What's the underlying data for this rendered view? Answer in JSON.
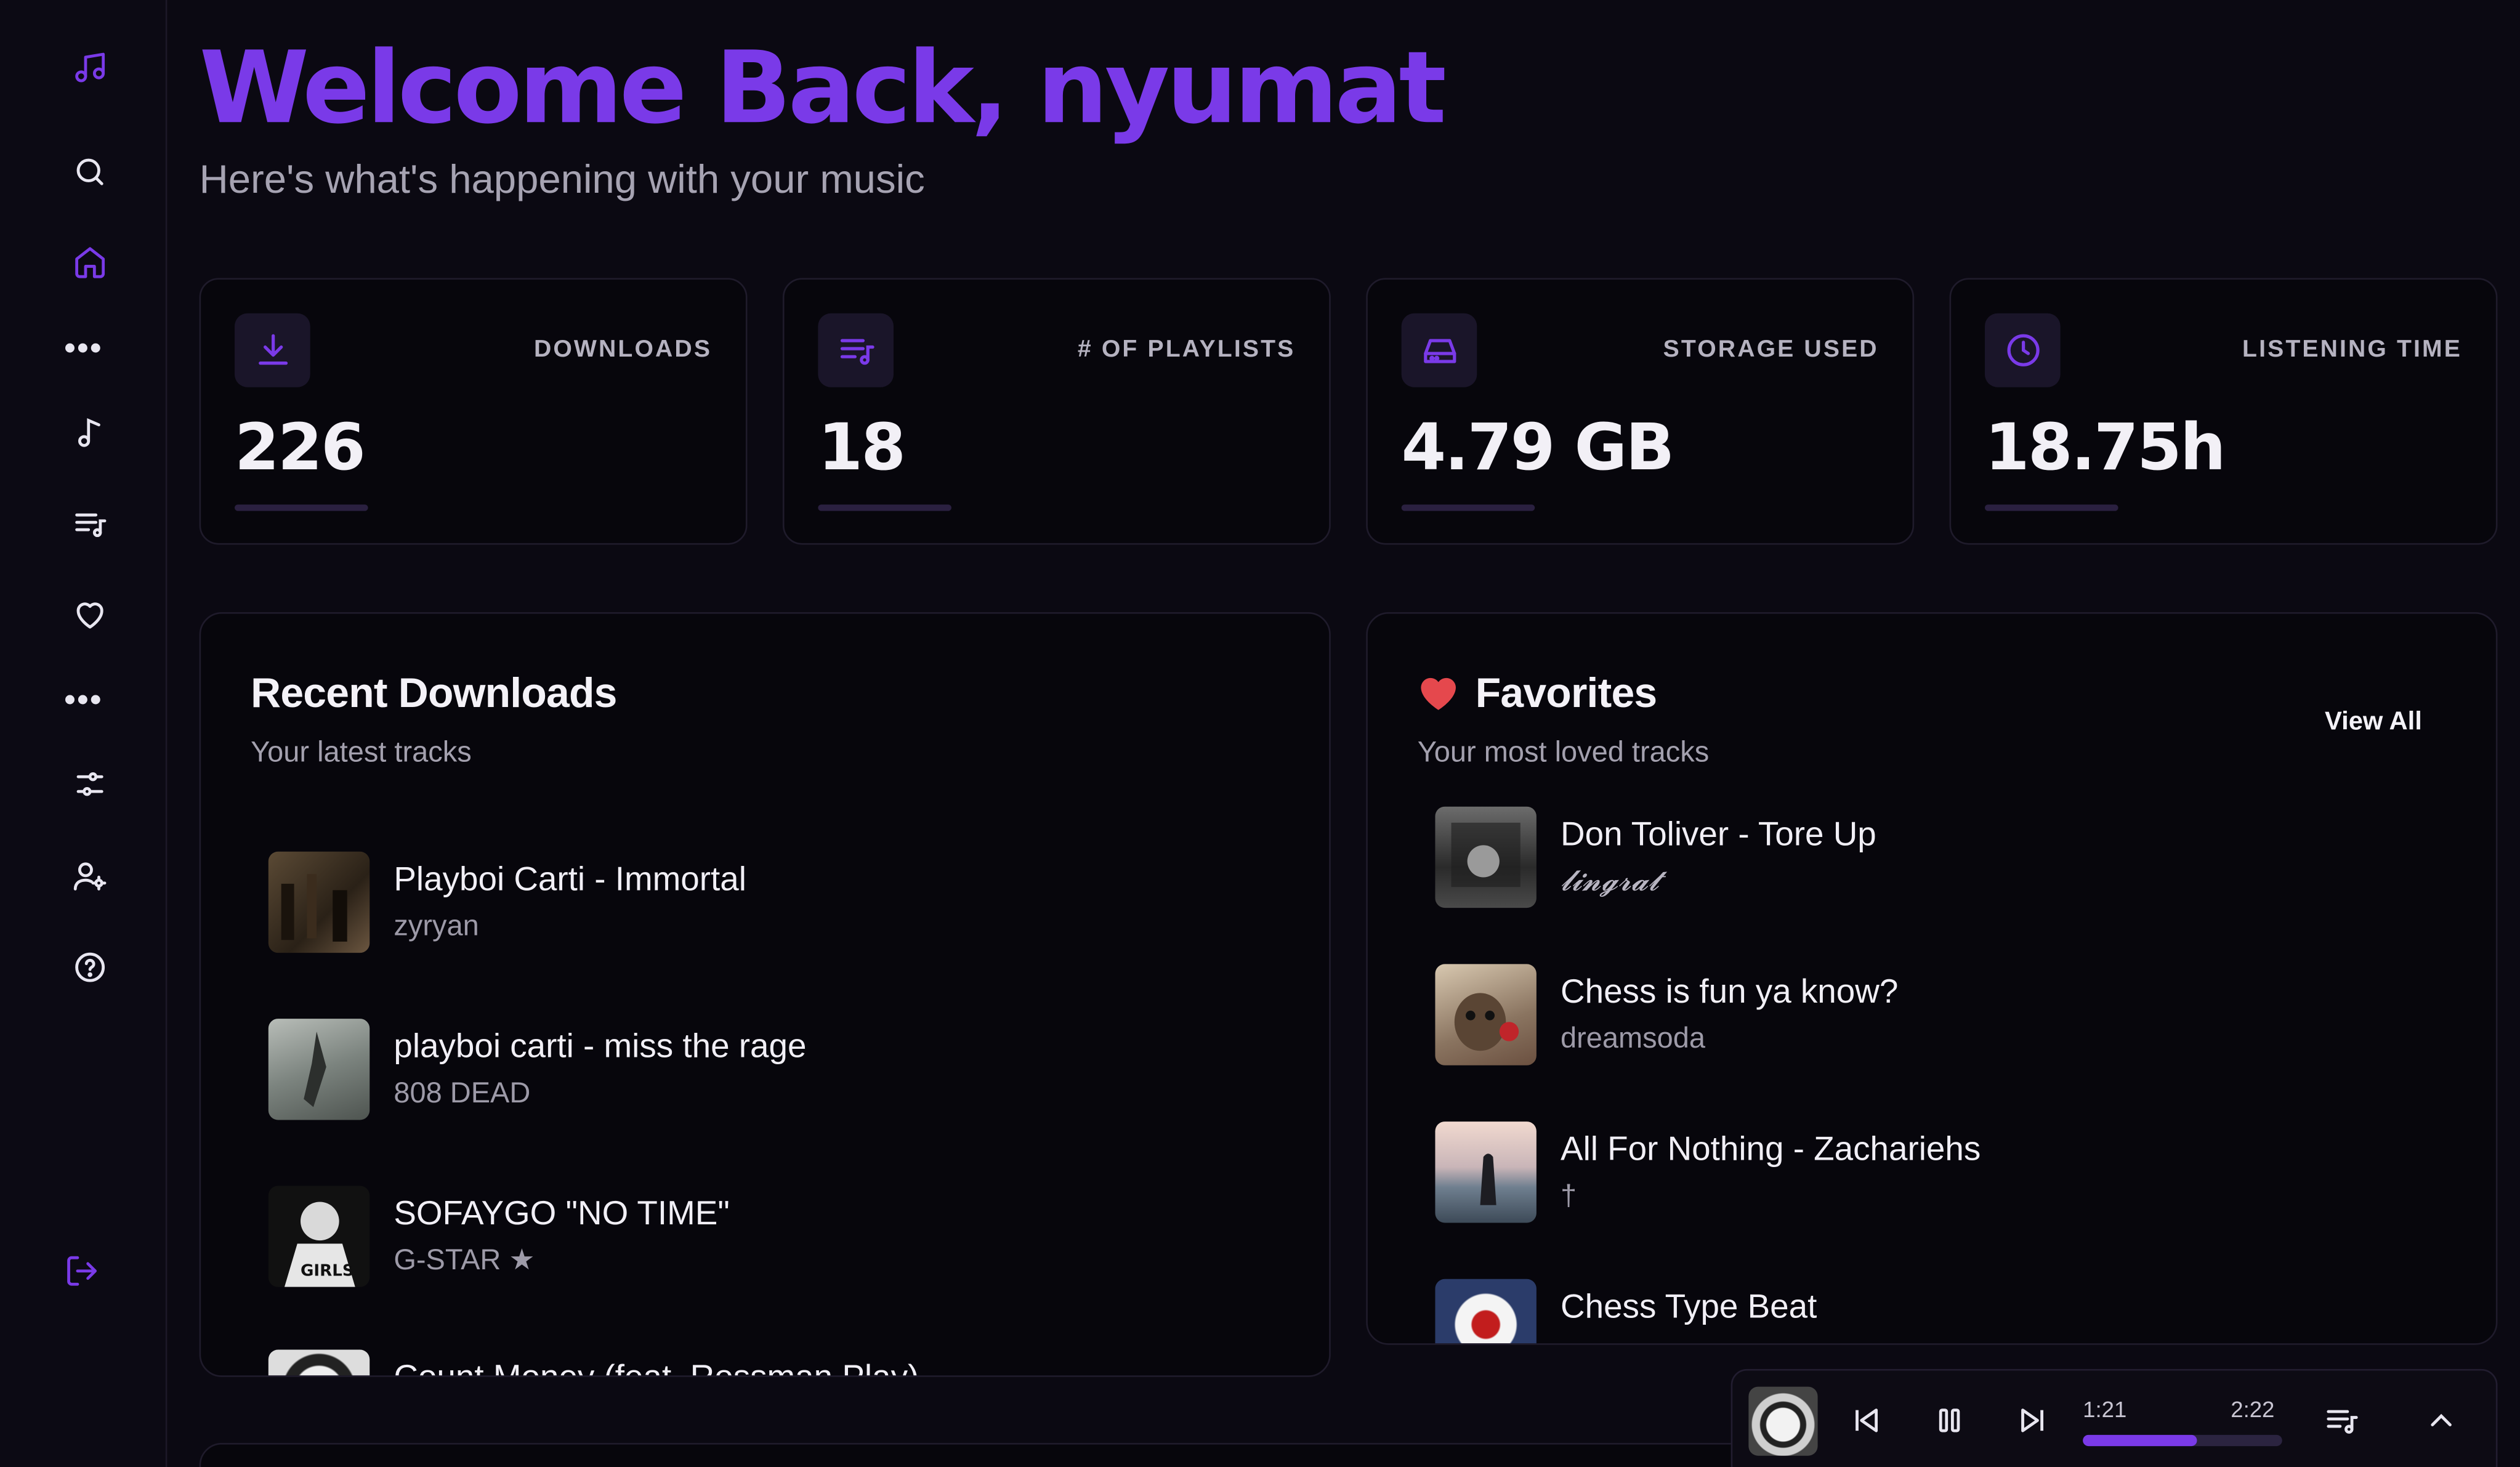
{
  "header": {
    "title": "Welcome Back, nyumat",
    "subtitle": "Here's what's happening with your music"
  },
  "colors": {
    "accent": "#7a3ae8",
    "background": "#0b0912",
    "card": "#07060c",
    "heart": "#e5484d"
  },
  "sidebar": {
    "items": [
      {
        "icon": "music-note-icon"
      },
      {
        "icon": "search-icon"
      },
      {
        "icon": "home-icon",
        "active": true
      },
      {
        "icon": "more-dots-icon"
      },
      {
        "icon": "single-note-icon"
      },
      {
        "icon": "playlist-icon"
      },
      {
        "icon": "heart-icon"
      },
      {
        "icon": "more-dots-icon"
      },
      {
        "icon": "sliders-icon"
      },
      {
        "icon": "user-settings-icon"
      },
      {
        "icon": "help-icon"
      },
      {
        "icon": "logout-icon"
      }
    ]
  },
  "stats": [
    {
      "label": "DOWNLOADS",
      "value": "226",
      "icon": "download-icon"
    },
    {
      "label": "# OF PLAYLISTS",
      "value": "18",
      "icon": "playlist-icon"
    },
    {
      "label": "STORAGE USED",
      "value": "4.79 GB",
      "icon": "hard-drive-icon"
    },
    {
      "label": "LISTENING TIME",
      "value": "18.75h",
      "icon": "clock-icon"
    }
  ],
  "recent": {
    "title": "Recent Downloads",
    "subtitle": "Your latest tracks",
    "tracks": [
      {
        "name": "Playboi Carti - Immortal",
        "artist": "zyryan"
      },
      {
        "name": "playboi carti - miss the rage",
        "artist": "808 DEAD"
      },
      {
        "name": "SOFAYGO \"NO TIME\"",
        "artist": "G-STAR ★"
      },
      {
        "name": "Count Money (feat. Rossman Play)",
        "artist": ""
      }
    ]
  },
  "favorites": {
    "title": "Favorites",
    "subtitle": "Your most loved tracks",
    "view_all": "View All",
    "tracks": [
      {
        "name": "Don Toliver - Tore Up",
        "artist": "𝓵𝓲𝓷𝓰𝓻𝓪𝓽"
      },
      {
        "name": "Chess is fun ya know?",
        "artist": "dreamsoda"
      },
      {
        "name": "All For Nothing - Zachariehs",
        "artist": "†"
      },
      {
        "name": "Chess Type Beat",
        "artist": ""
      }
    ]
  },
  "player": {
    "current_time": "1:21",
    "duration": "2:22",
    "progress": 0.57
  }
}
